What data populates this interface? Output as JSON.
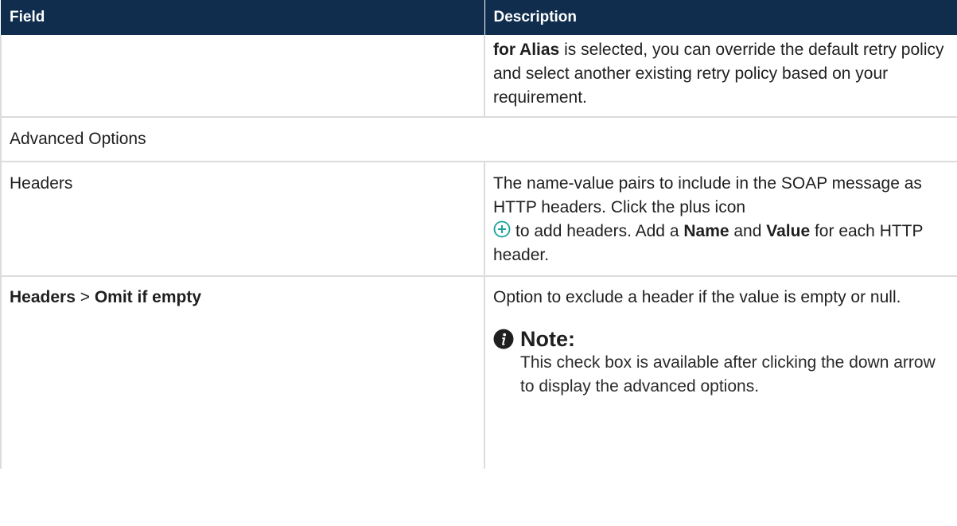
{
  "header": {
    "field": "Field",
    "description": "Description"
  },
  "rows": {
    "retry": {
      "desc_bold": "for Alias",
      "desc_rest": " is selected, you can override the default retry policy and select another existing retry policy based on your requirement."
    },
    "advanced": {
      "label": "Advanced Options"
    },
    "headers": {
      "field": "Headers",
      "desc_line1": "The name-value pairs to include in the SOAP message as HTTP headers. Click the plus icon",
      "desc_mid1": "to add headers. Add a ",
      "desc_name": "Name",
      "desc_mid2": " and ",
      "desc_value": "Value",
      "desc_end": " for each HTTP header."
    },
    "omit": {
      "field_a": "Headers",
      "field_sep": " > ",
      "field_b": "Omit if empty",
      "desc": "Option to exclude a header if the value is empty or null.",
      "note_title": "Note:",
      "note_body": "This check box is available after clicking the down arrow to display the advanced options."
    }
  },
  "icons": {
    "plus": "plus-circle-icon",
    "note": "info-icon"
  },
  "colors": {
    "header_bg": "#102d4e",
    "plus_icon": "#1aa39a",
    "grid": "#dcdcdc"
  }
}
